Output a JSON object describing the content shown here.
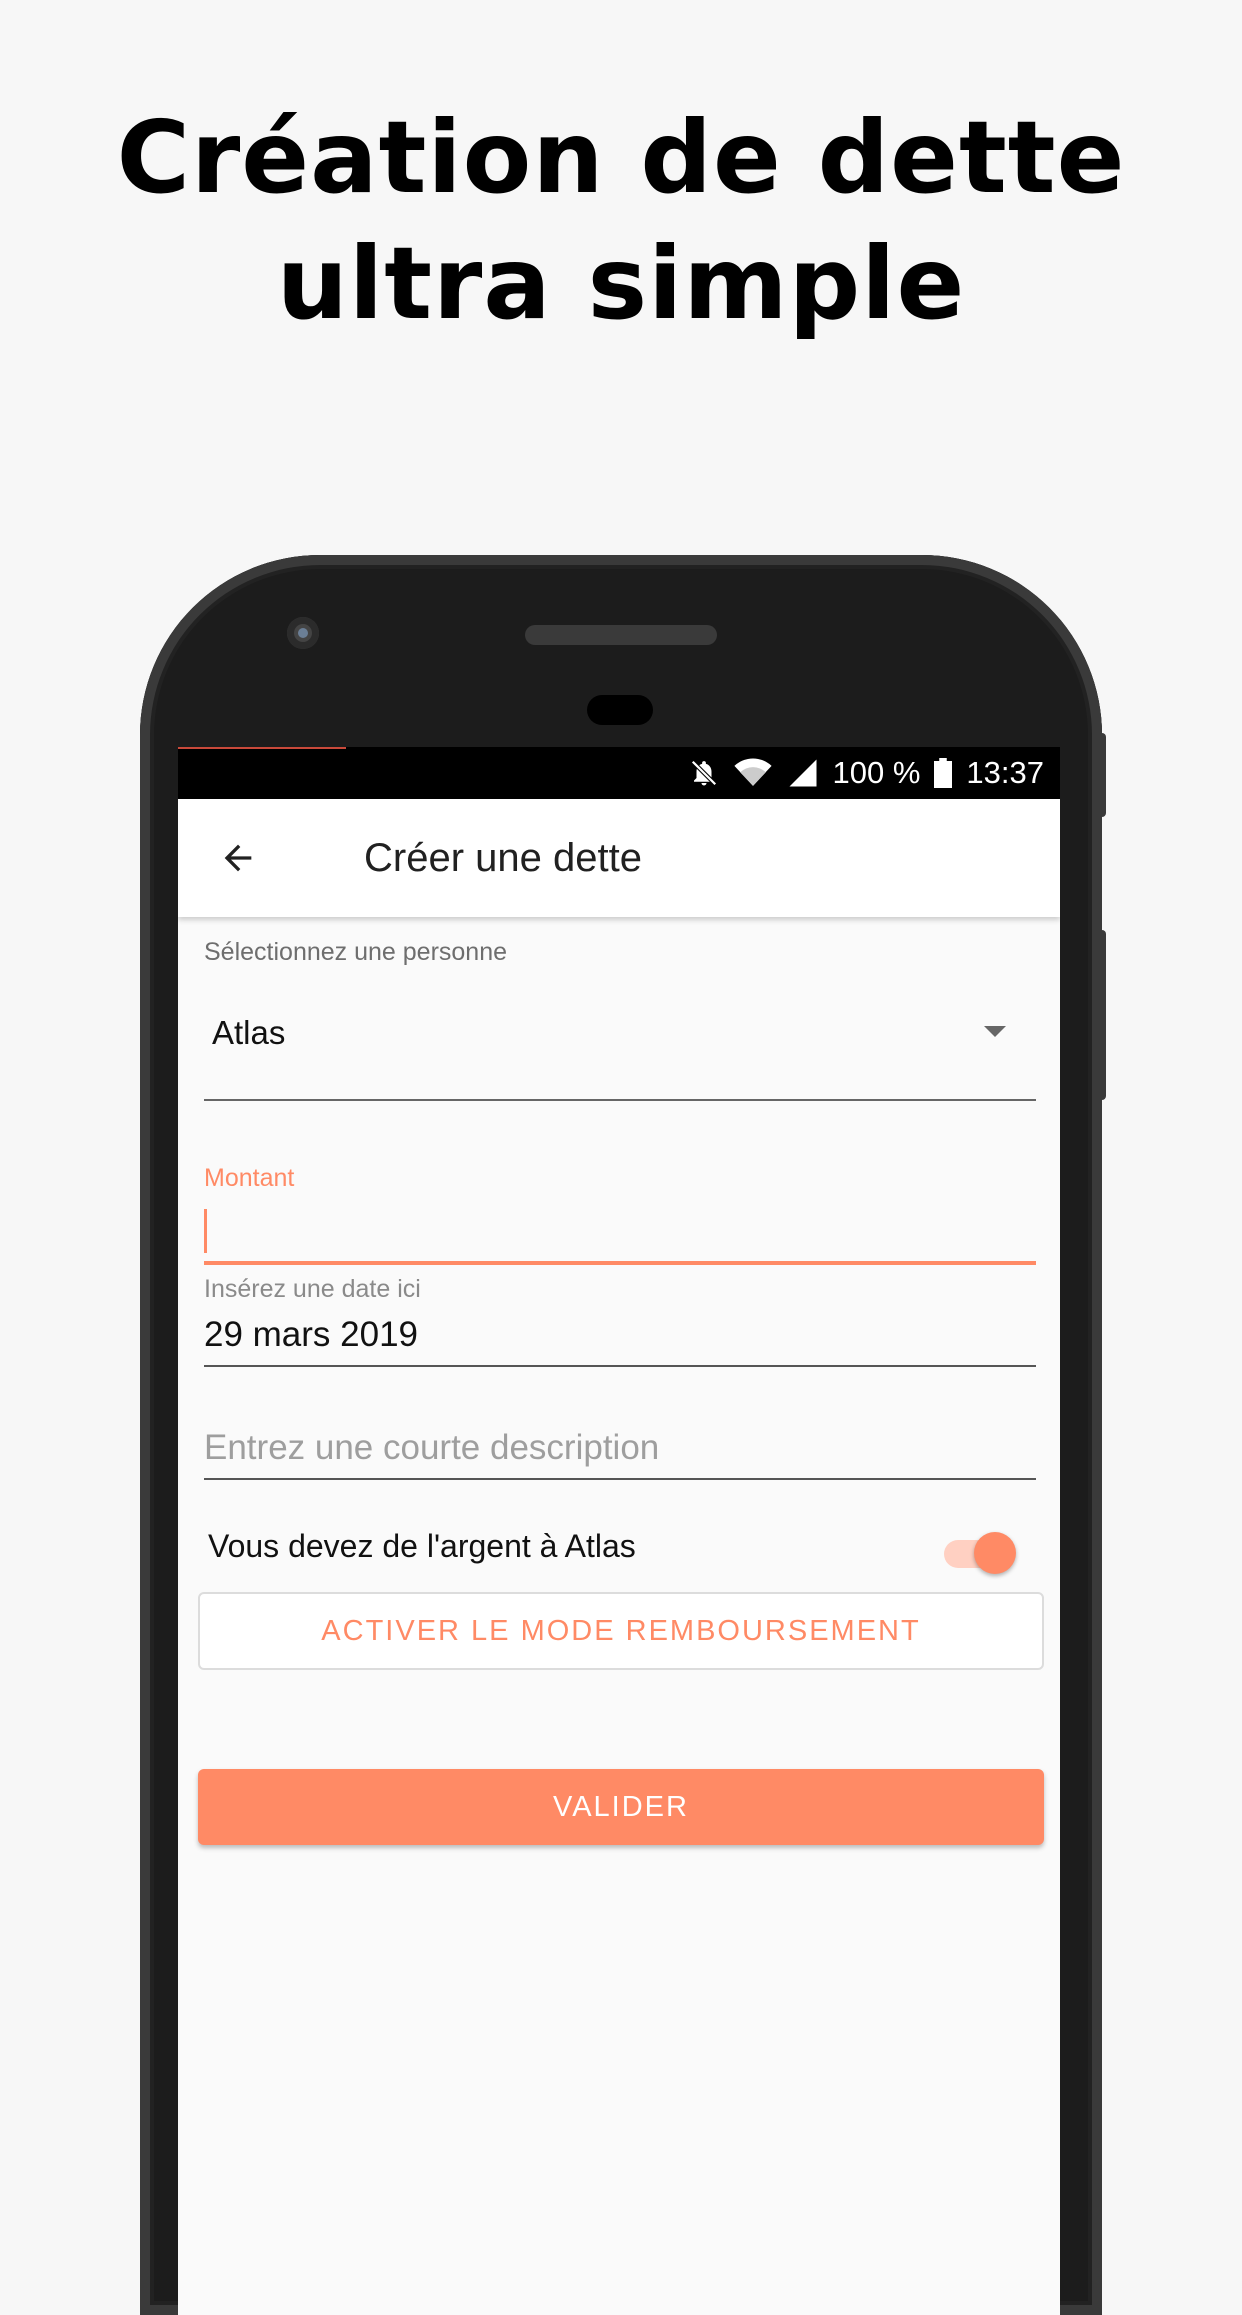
{
  "headline": {
    "line1": "Création de dette",
    "line2": "ultra simple"
  },
  "status_bar": {
    "battery": "100 %",
    "time": "13:37",
    "icons": [
      "bell-off-icon",
      "wifi-icon",
      "signal-icon",
      "battery-icon"
    ]
  },
  "appbar": {
    "title": "Créer une dette",
    "back_icon": "arrow-back-icon"
  },
  "form": {
    "person": {
      "label": "Sélectionnez une personne",
      "value": "Atlas"
    },
    "amount": {
      "label": "Montant",
      "value": ""
    },
    "date": {
      "label": "Insérez une date ici",
      "value": "29 mars 2019"
    },
    "description": {
      "placeholder": "Entrez une courte description",
      "value": ""
    },
    "owe_toggle": {
      "label": "Vous devez de l'argent à Atlas",
      "checked": true
    },
    "refund_button": "ACTIVER LE MODE REMBOURSEMENT",
    "submit_button": "VALIDER"
  },
  "colors": {
    "accent": "#ff8a65",
    "accent_light": "#ffd0c2"
  }
}
